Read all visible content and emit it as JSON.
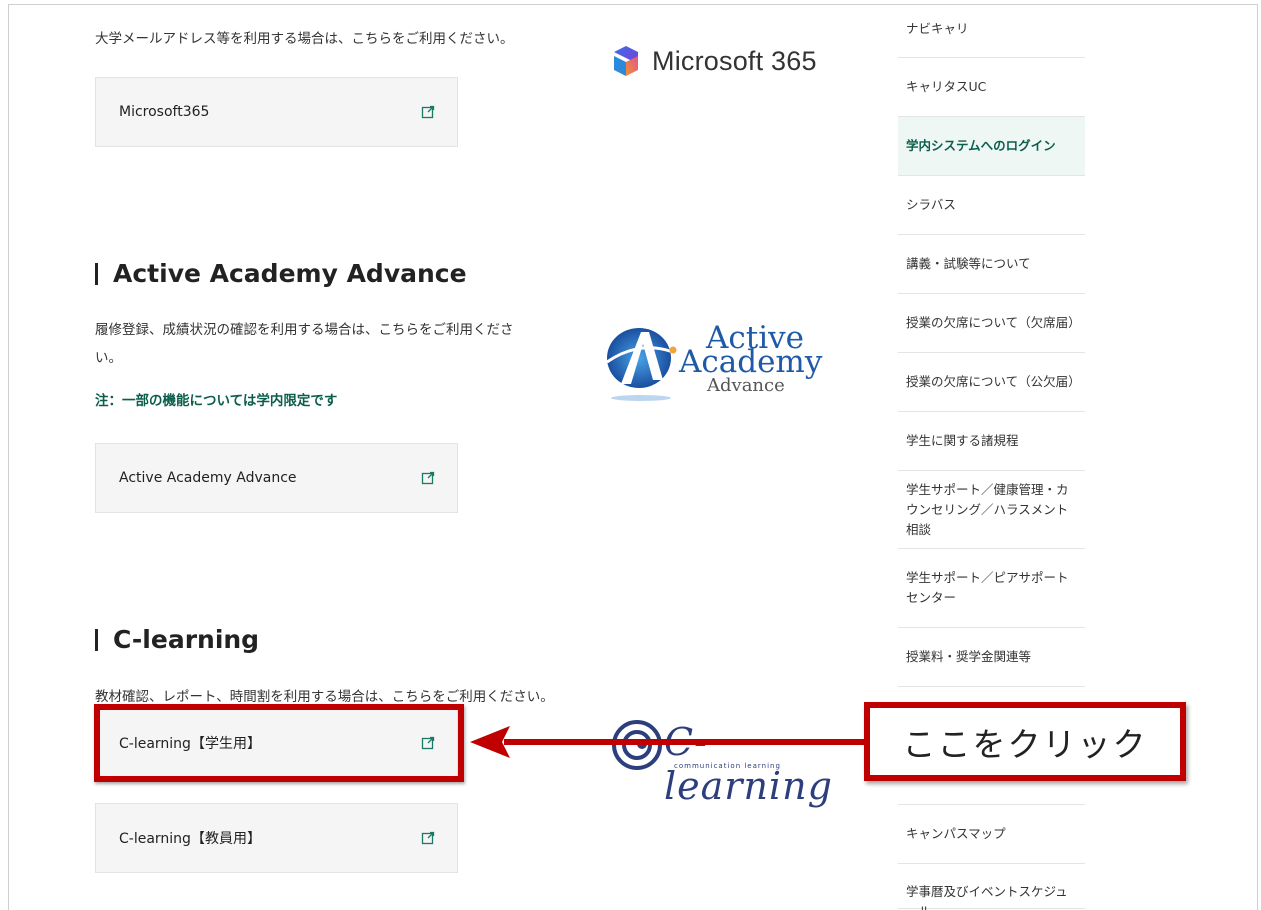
{
  "intro_text": "大学メールアドレス等を利用する場合は、こちらをご利用ください。",
  "links": {
    "microsoft365": "Microsoft365",
    "active_academy": "Active Academy Advance",
    "clearning_student": "C-learning【学生用】",
    "clearning_teacher": "C-learning【教員用】"
  },
  "sections": {
    "aaa": {
      "title": "Active Academy Advance",
      "desc_line1": "履修登録、成績状況の確認を利用する場合は、こちらをご利用くださ",
      "desc_line2": "い。",
      "note": "注：一部の機能については学内限定です"
    },
    "clearning": {
      "title": "C-learning",
      "desc": "教材確認、レポート、時間割を利用する場合は、こちらをご利用ください。"
    }
  },
  "logos": {
    "ms": "Microsoft 365",
    "aaa_1": "Active",
    "aaa_2": "Academy",
    "aaa_3": "Advance",
    "cl_1": "C-learning",
    "cl_2": "communication learning"
  },
  "sidebar": {
    "items": [
      "ナビキャリ",
      "キャリタスUC",
      "学内システムへのログイン",
      "シラバス",
      "講義・試験等について",
      "授業の欠席について（欠席届）",
      "授業の欠席について（公欠届）",
      "学生に関する諸規程",
      "学生サポート／健康管理・カウンセリング／ハラスメント相談",
      "学生サポート／ピアサポートセンター",
      "授業料・奨学金関連等",
      "キャンパスマップ",
      "学事暦及びイベントスケジュール"
    ]
  },
  "annotation": {
    "callout": "ここをクリック"
  },
  "colors": {
    "accent_red": "#c00000",
    "note_green": "#0b5e4b"
  }
}
